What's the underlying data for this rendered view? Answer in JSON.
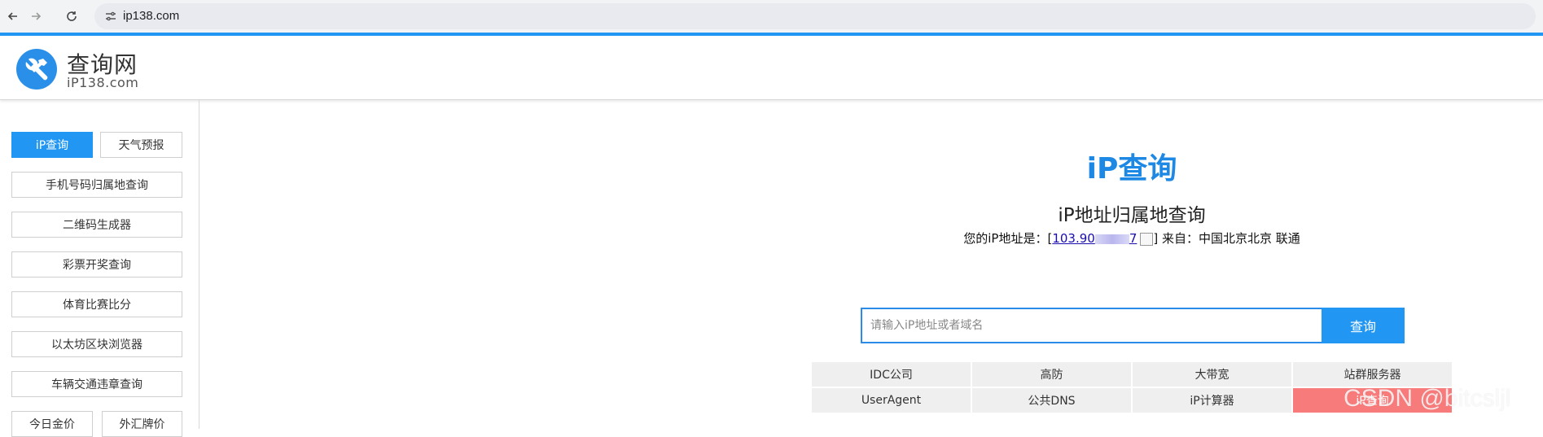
{
  "browser": {
    "url": "ip138.com",
    "back_icon": "arrow-left-icon",
    "forward_icon": "arrow-right-icon",
    "reload_icon": "reload-icon",
    "site_info_icon": "tune-icon"
  },
  "header": {
    "logo_icon": "tools-icon",
    "title": "查询网",
    "subtitle": "iP138.com"
  },
  "sidebar": {
    "items": [
      {
        "label": "iP查询",
        "active": true
      },
      {
        "label": "天气预报"
      },
      {
        "label": "手机号码归属地查询"
      },
      {
        "label": "二维码生成器"
      },
      {
        "label": "彩票开奖查询"
      },
      {
        "label": "体育比赛比分"
      },
      {
        "label": "以太坊区块浏览器"
      },
      {
        "label": "车辆交通违章查询"
      },
      {
        "label": "今日金价"
      },
      {
        "label": "外汇牌价"
      }
    ]
  },
  "main": {
    "title": "iP查询",
    "subtitle": "iP地址归属地查询",
    "ip_prefix": "您的iP地址是：[",
    "ip_visible_start": "103.90",
    "ip_visible_end": "7",
    "ip_suffix": "] 来自：中国北京北京 联通",
    "search": {
      "placeholder": "请输入iP地址或者域名",
      "button": "查询"
    },
    "tools": [
      [
        "IDC公司",
        "高防",
        "大带宽",
        "站群服务器"
      ],
      [
        "UserAgent",
        "公共DNS",
        "iP计算器",
        "iP查询"
      ]
    ]
  },
  "watermark": "CSDN @bitcsljl",
  "colors": {
    "accent": "#2196f3",
    "title_blue": "#1e88e5",
    "highlight_cell": "#f87b7b"
  }
}
